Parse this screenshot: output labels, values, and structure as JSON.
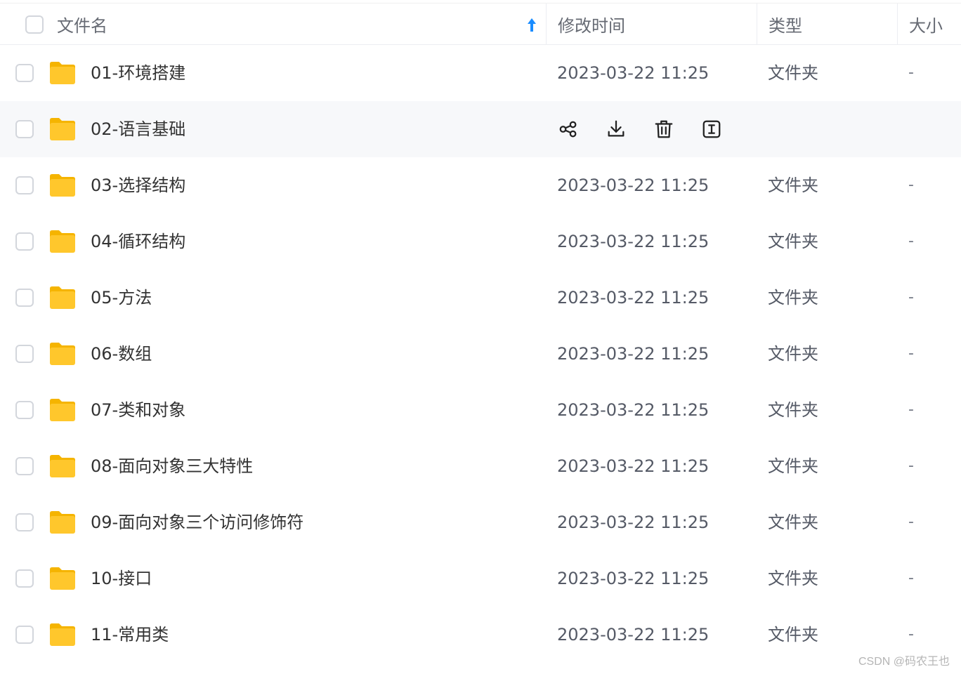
{
  "header": {
    "name_label": "文件名",
    "time_label": "修改时间",
    "type_label": "类型",
    "size_label": "大小",
    "sort_icon": "sort-ascending-arrow-icon",
    "accent_color": "#1a8cff"
  },
  "files": [
    {
      "name": "01-环境搭建",
      "modified": "2023-03-22 11:25",
      "type": "文件夹",
      "size": "-"
    },
    {
      "name": "02-语言基础",
      "modified": "",
      "type": "",
      "size": "",
      "hovered": true
    },
    {
      "name": "03-选择结构",
      "modified": "2023-03-22 11:25",
      "type": "文件夹",
      "size": "-"
    },
    {
      "name": "04-循环结构",
      "modified": "2023-03-22 11:25",
      "type": "文件夹",
      "size": "-"
    },
    {
      "name": "05-方法",
      "modified": "2023-03-22 11:25",
      "type": "文件夹",
      "size": "-"
    },
    {
      "name": "06-数组",
      "modified": "2023-03-22 11:25",
      "type": "文件夹",
      "size": "-"
    },
    {
      "name": "07-类和对象",
      "modified": "2023-03-22 11:25",
      "type": "文件夹",
      "size": "-"
    },
    {
      "name": "08-面向对象三大特性",
      "modified": "2023-03-22 11:25",
      "type": "文件夹",
      "size": "-"
    },
    {
      "name": "09-面向对象三个访问修饰符",
      "modified": "2023-03-22 11:25",
      "type": "文件夹",
      "size": "-"
    },
    {
      "name": "10-接口",
      "modified": "2023-03-22 11:25",
      "type": "文件夹",
      "size": "-"
    },
    {
      "name": "11-常用类",
      "modified": "2023-03-22 11:25",
      "type": "文件夹",
      "size": "-"
    }
  ],
  "row_actions": [
    "share-icon",
    "download-icon",
    "delete-icon",
    "rename-icon"
  ],
  "folder_color": "#ffc72c",
  "watermark": "CSDN @码农王也"
}
